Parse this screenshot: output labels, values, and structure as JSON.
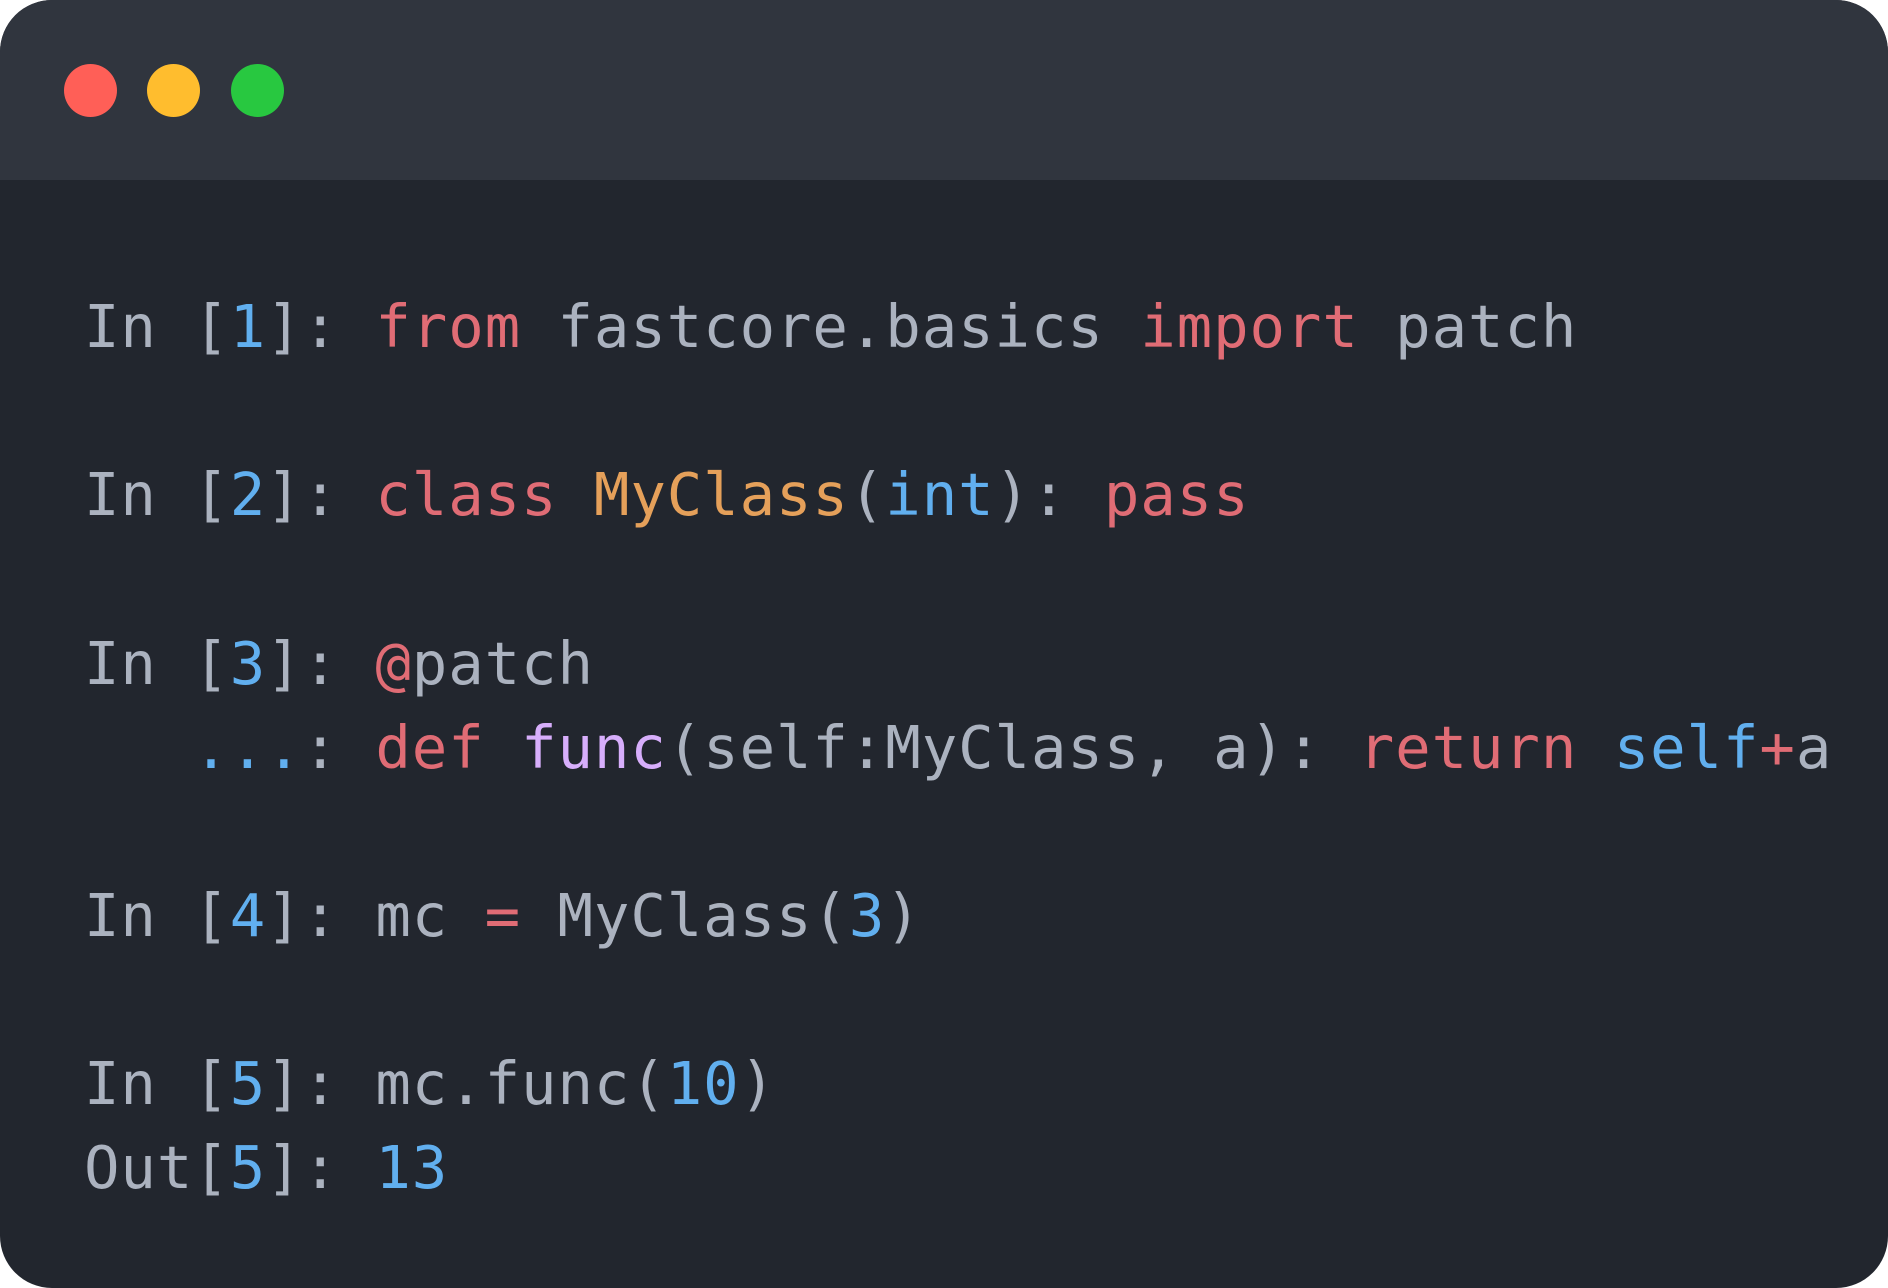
{
  "window": {
    "controls": [
      {
        "name": "close",
        "color": "#ff5f57"
      },
      {
        "name": "minimize",
        "color": "#ffbd2e"
      },
      {
        "name": "maximize",
        "color": "#28c840"
      }
    ]
  },
  "cells": [
    {
      "prompt": "In [",
      "number": "1",
      "prompt_end": "]: ",
      "code": {
        "kw_from": "from",
        "module": " fastcore.basics ",
        "kw_import": "import",
        "name": " patch"
      }
    },
    {
      "prompt": "In [",
      "number": "2",
      "prompt_end": "]: ",
      "code": {
        "kw_class": "class",
        "sp1": " ",
        "class_name": "MyClass",
        "paren_open": "(",
        "base": "int",
        "paren_close": "): ",
        "kw_pass": "pass"
      }
    },
    {
      "prompt": "In [",
      "number": "3",
      "prompt_end": "]: ",
      "code": {
        "at": "@",
        "decorator": "patch"
      },
      "continuation": {
        "dots": "   ...",
        "colon": ": ",
        "kw_def": "def",
        "sp": " ",
        "func_name": "func",
        "args": "(self:MyClass, a): ",
        "kw_return": "return",
        "sp2": " ",
        "self": "self",
        "op": "+",
        "var": "a"
      }
    },
    {
      "prompt": "In [",
      "number": "4",
      "prompt_end": "]: ",
      "code": {
        "var": "mc ",
        "op": "=",
        "call": " MyClass(",
        "arg": "3",
        "close": ")"
      }
    },
    {
      "prompt": "In [",
      "number": "5",
      "prompt_end": "]: ",
      "code": {
        "call": "mc.func(",
        "arg": "10",
        "close": ")"
      },
      "output": {
        "prompt": "Out[",
        "number": "5",
        "prompt_end": "]: ",
        "value": "13"
      }
    }
  ]
}
